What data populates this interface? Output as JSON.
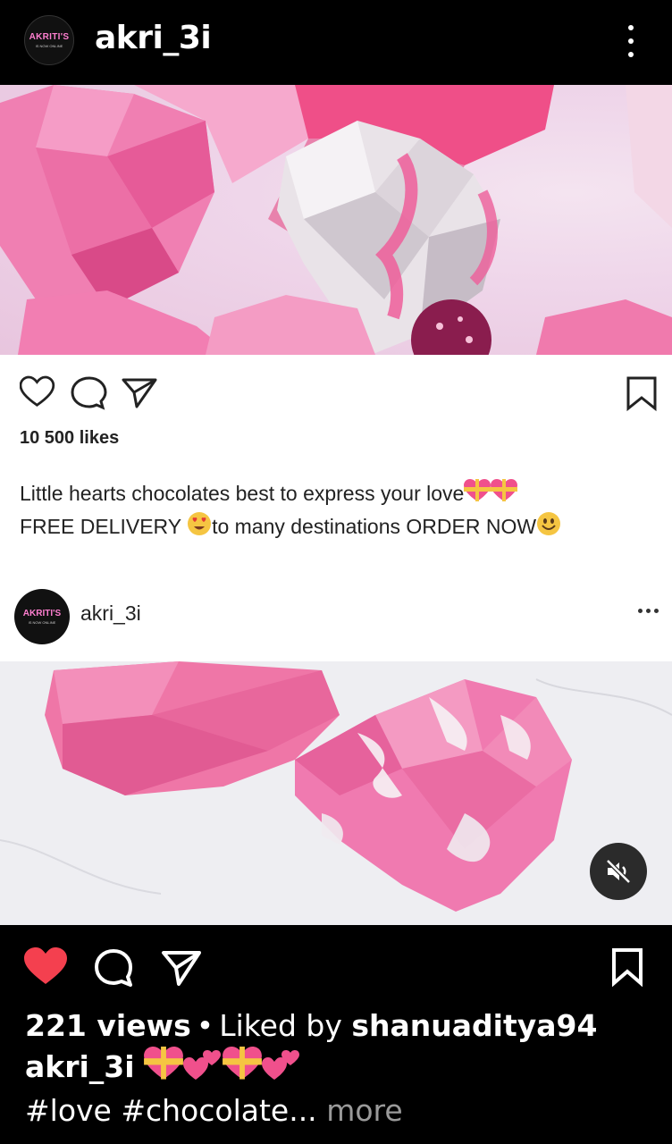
{
  "header": {
    "username": "akri_3i",
    "avatar_text": "AKRITI'S",
    "avatar_subtext": "IS NOW ONLINE"
  },
  "inner_post": {
    "likes": "10 500 likes",
    "caption_line1": "Little hearts chocolates best to express your love",
    "caption_line2_a": "FREE DELIVERY ",
    "caption_line2_b": "to many destinations ORDER NOW",
    "author": "akri_3i",
    "author_avatar_text": "AKRITI'S",
    "author_avatar_subtext": "IS NOW ONLINE"
  },
  "footer": {
    "views": "221 views",
    "separator": "•",
    "liked_by_prefix": "Liked by ",
    "liked_by_user": "shanuaditya94",
    "caption_user": "akri_3i",
    "hashtags": "#love #chocolate",
    "ellipsis": "...",
    "more": "more"
  },
  "colors": {
    "like_red": "#f4404f",
    "accent_pink": "#ff7fd0"
  },
  "icons": [
    "heart-filled-icon",
    "comment-icon",
    "share-icon",
    "bookmark-icon",
    "mute-icon",
    "more-icon"
  ]
}
